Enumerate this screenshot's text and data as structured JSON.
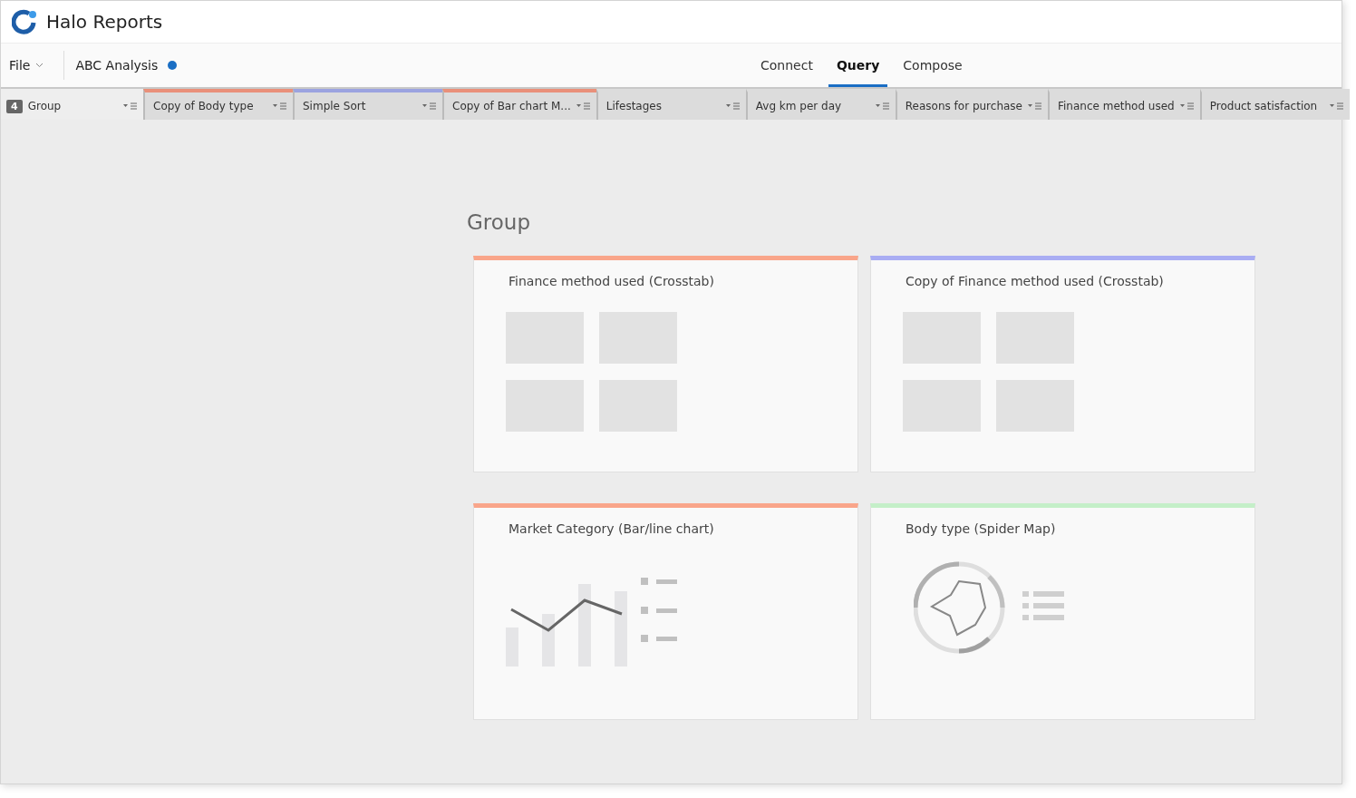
{
  "app": {
    "title": "Halo Reports"
  },
  "toolbar": {
    "file_menu": "File",
    "document": "ABC Analysis",
    "nav": [
      {
        "label": "Connect",
        "selected": false
      },
      {
        "label": "Query",
        "selected": true
      },
      {
        "label": "Compose",
        "selected": false
      }
    ]
  },
  "query_tabs": [
    {
      "badge": "4",
      "label": "Group",
      "selected": true
    },
    {
      "label": "Copy of Body type",
      "selected": false,
      "color": "#e9907a"
    },
    {
      "label": "Simple Sort",
      "selected": false,
      "color": "#9ba3e0"
    },
    {
      "label": "Copy of Bar chart M...",
      "selected": false,
      "color": "#e9907a"
    },
    {
      "label": "Lifestages",
      "selected": false
    },
    {
      "label": "Avg km per day",
      "selected": false
    },
    {
      "label": "Reasons for purchase",
      "selected": false
    },
    {
      "label": "Finance method used",
      "selected": false
    },
    {
      "label": "Product satisfaction",
      "selected": false
    }
  ],
  "group": {
    "title": "Group",
    "cards": [
      {
        "title": "Finance method used (Crosstab)",
        "kind": "crosstab",
        "color": "#f9a58a"
      },
      {
        "title": "Copy of Finance method used (Crosstab)",
        "kind": "crosstab",
        "color": "#a9adf3"
      },
      {
        "title": "Market Category (Bar/line chart)",
        "kind": "barline",
        "color": "#f9a58a"
      },
      {
        "title": "Body type (Spider Map)",
        "kind": "spider",
        "color": "#c4efc8"
      }
    ]
  }
}
